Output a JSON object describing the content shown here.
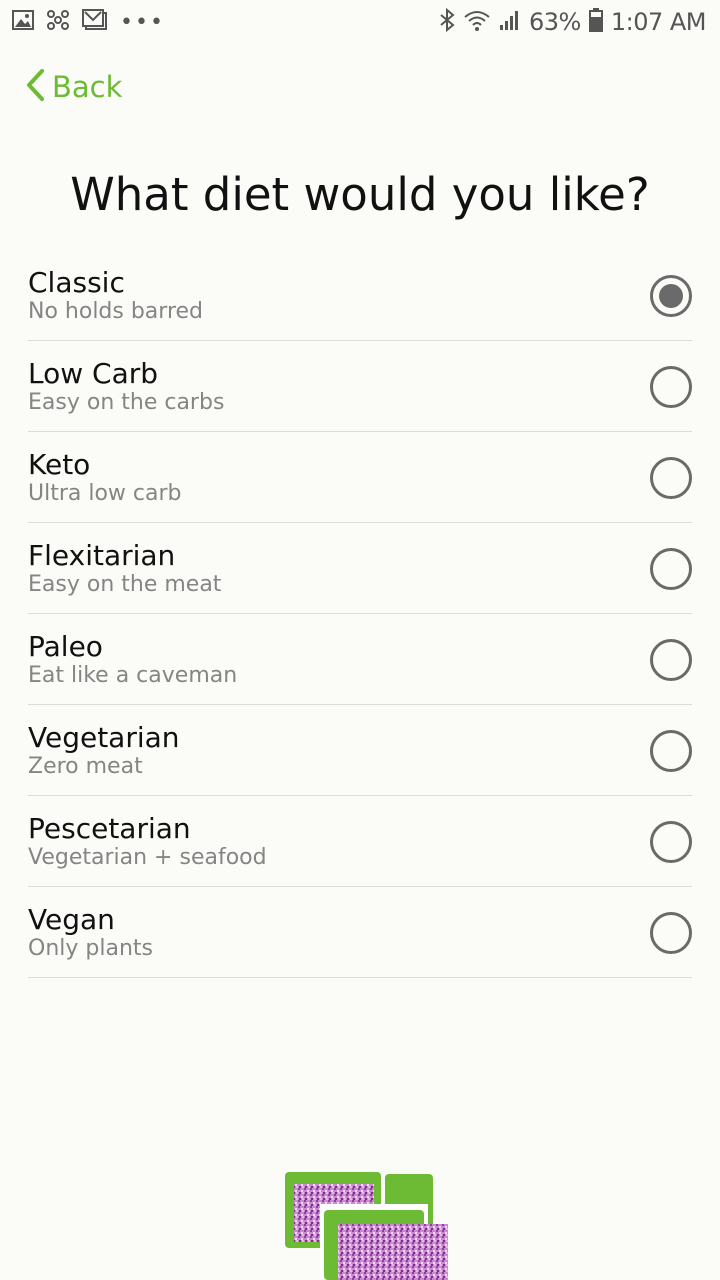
{
  "status_bar": {
    "battery": "63%",
    "time": "1:07 AM",
    "left_icons": [
      "gallery-icon",
      "app-icon",
      "gmail-icon",
      "more-dots-icon"
    ],
    "right_icons": [
      "bluetooth-icon",
      "wifi-icon",
      "signal-icon",
      "battery-icon"
    ]
  },
  "nav": {
    "back_label": "Back"
  },
  "title": "What diet would you like?",
  "diets": [
    {
      "name": "Classic",
      "description": "No holds barred",
      "selected": true
    },
    {
      "name": "Low Carb",
      "description": "Easy on the carbs",
      "selected": false
    },
    {
      "name": "Keto",
      "description": "Ultra low carb",
      "selected": false
    },
    {
      "name": "Flexitarian",
      "description": "Easy on the meat",
      "selected": false
    },
    {
      "name": "Paleo",
      "description": "Eat like a caveman",
      "selected": false
    },
    {
      "name": "Vegetarian",
      "description": "Zero meat",
      "selected": false
    },
    {
      "name": "Pescetarian",
      "description": "Vegetarian + seafood",
      "selected": false
    },
    {
      "name": "Vegan",
      "description": "Only plants",
      "selected": false
    }
  ],
  "colors": {
    "accent": "#6dbb34",
    "background": "#fbfbf8",
    "radio": "#6a6a6a",
    "secondary_text": "#858585"
  }
}
